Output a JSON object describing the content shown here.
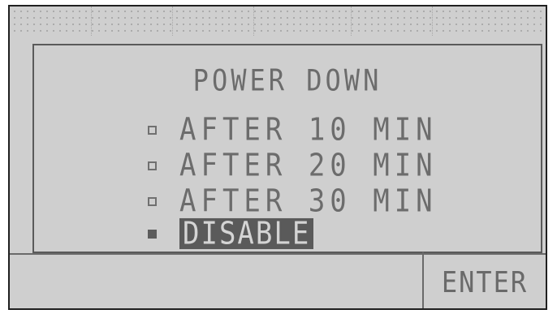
{
  "screen": {
    "title": "POWER DOWN",
    "options": [
      {
        "label": "AFTER 10 MIN",
        "selected": false
      },
      {
        "label": "AFTER 20 MIN",
        "selected": false
      },
      {
        "label": "AFTER 30 MIN",
        "selected": false
      },
      {
        "label": "DISABLE",
        "selected": true
      }
    ],
    "enter_label": "ENTER"
  },
  "colors": {
    "lcd_background": "#cfcfcf",
    "text": "#6c6c6c",
    "highlight": "#5a5a5a"
  }
}
